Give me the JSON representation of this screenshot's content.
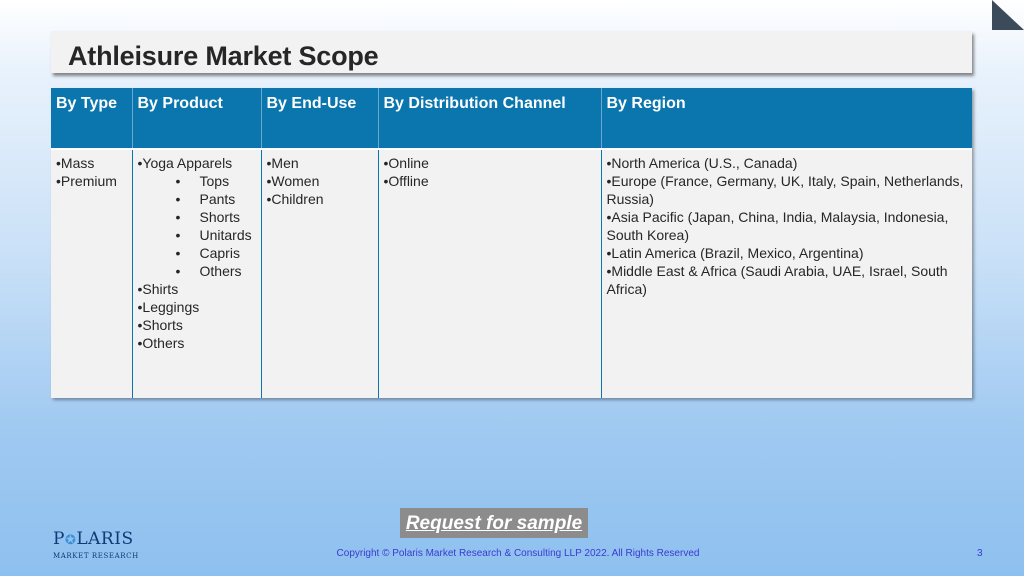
{
  "slide": {
    "title": "Athleisure Market Scope",
    "page_number": "3",
    "copyright": "Copyright © Polaris Market Research & Consulting LLP 2022. All Rights Reserved"
  },
  "table": {
    "headers": [
      "By Type",
      "By Product",
      "By End-Use",
      "By Distribution Channel",
      "By Region"
    ],
    "type": [
      "•Mass",
      "•Premium"
    ],
    "product_main": "•Yoga Apparels",
    "product_sub": [
      "Tops",
      "Pants",
      "Shorts",
      "Unitards",
      "Capris",
      "Others"
    ],
    "product_rest": [
      "•Shirts",
      "•Leggings",
      "•Shorts",
      "•Others"
    ],
    "end_use": [
      "•Men",
      "•Women",
      "•Children"
    ],
    "distribution": [
      "•Online",
      "•Offline"
    ],
    "region": [
      "•North America (U.S., Canada)",
      "•Europe (France, Germany, UK, Italy, Spain, Netherlands, Russia)",
      "•Asia Pacific (Japan, China, India, Malaysia, Indonesia, South Korea)",
      "•Latin America (Brazil, Mexico, Argentina)",
      "•Middle East & Africa (Saudi Arabia, UAE, Israel, South Africa)"
    ],
    "sub_bullet": "•"
  },
  "cta": {
    "label": "Request for sample"
  },
  "logo": {
    "word_left": "P",
    "word_right": "LARIS",
    "tagline": "MARKET RESEARCH"
  },
  "colors": {
    "header_bg": "#0a76ad",
    "cell_bg": "#f2f2f2",
    "button_bg": "#8c8c8c",
    "logo_color": "#0d3b78"
  }
}
